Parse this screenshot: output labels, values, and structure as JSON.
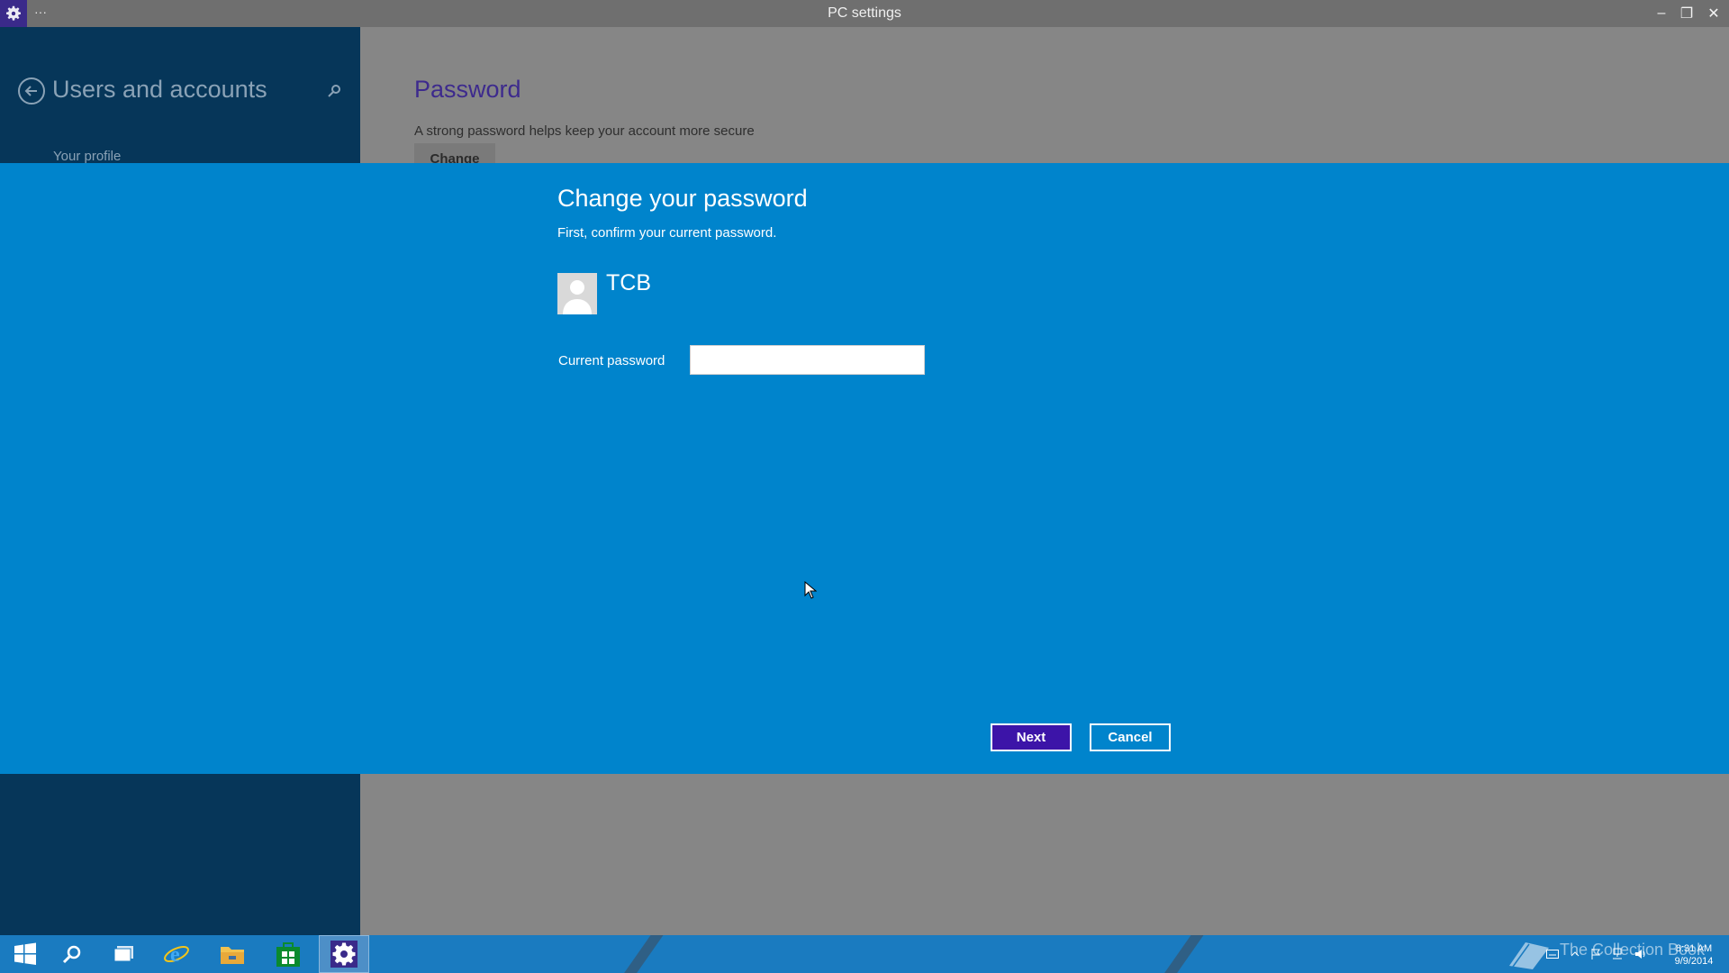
{
  "window": {
    "title": "PC settings",
    "menu_label": "···",
    "minimize_glyph": "–",
    "restore_glyph": "❐",
    "close_glyph": "✕"
  },
  "sidebar": {
    "title": "Users and accounts",
    "items": [
      {
        "label": "Your profile"
      }
    ]
  },
  "main": {
    "heading": "Password",
    "description": "A strong password helps keep your account more secure",
    "change_label": "Change"
  },
  "dialog": {
    "title": "Change your password",
    "subtitle": "First, confirm your current password.",
    "username": "TCB",
    "field_label": "Current password",
    "field_value": "",
    "next_label": "Next",
    "cancel_label": "Cancel"
  },
  "taskbar": {
    "watermark": "The Collection Book",
    "clock_time": "8:31 AM",
    "clock_date": "9/9/2014"
  },
  "colors": {
    "dialog_bg": "#0084cc",
    "sidebar_bg": "#063659",
    "accent": "#3c14a8",
    "taskbar_bg": "#1a7bc0"
  },
  "icons": {
    "app": "gear-icon",
    "back": "back-arrow-icon",
    "search": "search-icon",
    "avatar": "user-avatar-icon",
    "start": "windows-logo-icon",
    "browser": "internet-explorer-icon",
    "explorer": "file-explorer-icon",
    "store": "store-icon",
    "settings": "settings-gear-icon"
  }
}
